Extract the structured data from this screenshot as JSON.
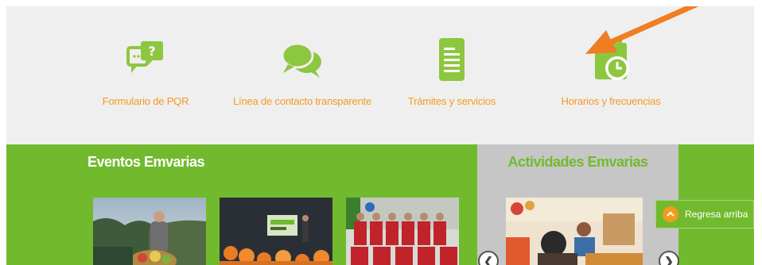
{
  "shortcuts": [
    {
      "label": "Formulario de PQR",
      "icon": "question-chat-icon"
    },
    {
      "label": "Línea de contacto transparente",
      "icon": "chat-bubbles-icon"
    },
    {
      "label": "Trámites y servicios",
      "icon": "document-icon"
    },
    {
      "label": "Horarios y frecuencias",
      "icon": "calendar-clock-icon"
    }
  ],
  "events": {
    "title": "Eventos Emvarias",
    "photos": [
      "person-with-produce-photo",
      "auditorium-presentation-photo",
      "soccer-team-photo"
    ]
  },
  "activities": {
    "title": "Actividades Emvarias",
    "photos": [
      "children-activity-photo"
    ]
  },
  "back_to_top": {
    "label": "Regresa arriba"
  },
  "colors": {
    "brand_green": "#72ba2d",
    "icon_green": "#8dc63f",
    "link_orange": "#f39b1f",
    "annotation_arrow": "#ef7d22",
    "panel_gray": "#c6c6c6",
    "background_gray": "#efefef"
  }
}
